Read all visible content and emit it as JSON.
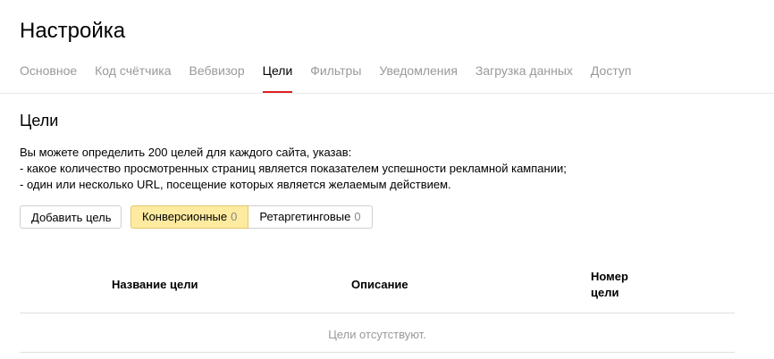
{
  "page": {
    "title": "Настройка"
  },
  "tabs": [
    {
      "label": "Основное"
    },
    {
      "label": "Код счётчика"
    },
    {
      "label": "Вебвизор"
    },
    {
      "label": "Цели",
      "active": true
    },
    {
      "label": "Фильтры"
    },
    {
      "label": "Уведомления"
    },
    {
      "label": "Загрузка данных"
    },
    {
      "label": "Доступ"
    }
  ],
  "section": {
    "title": "Цели",
    "description": [
      "Вы можете определить 200 целей для каждого сайта, указав:",
      "- какое количество просмотренных страниц является показателем успешности рекламной кампании;",
      "- один или несколько URL, посещение которых является желаемым действием."
    ]
  },
  "buttons": {
    "add_goal": "Добавить цель"
  },
  "goal_types": [
    {
      "label": "Конверсионные",
      "count": "0",
      "selected": true
    },
    {
      "label": "Ретаргетинговые",
      "count": "0",
      "selected": false
    }
  ],
  "table": {
    "columns": [
      "Название цели",
      "Описание",
      "Номер цели"
    ],
    "empty_text": "Цели отсутствуют."
  },
  "colors": {
    "accent_red": "#e02020",
    "selected_bg": "#ffeba0",
    "muted_text": "#999999"
  }
}
